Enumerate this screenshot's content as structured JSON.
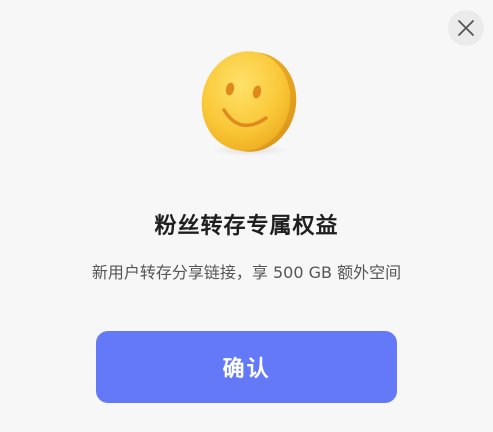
{
  "dialog": {
    "title": "粉丝转存专属权益",
    "subtitle": "新用户转存分享链接，享 500 GB 额外空间",
    "confirm_label": "确认",
    "close_icon": "close-icon",
    "illustration_icon": "smiley-face-icon"
  },
  "colors": {
    "background": "#f7f7f7",
    "accent": "#6479f8",
    "emoji_yellow": "#f7c33a"
  }
}
